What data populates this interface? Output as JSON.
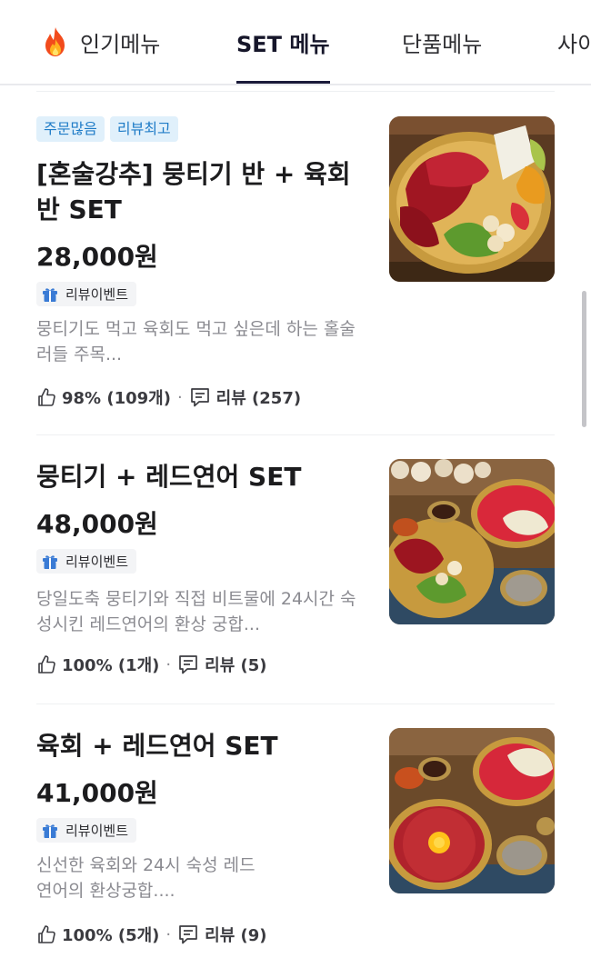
{
  "tabs": [
    {
      "label": "인기메뉴",
      "icon": "fire-icon",
      "active": false
    },
    {
      "label": "SET 메뉴",
      "active": true
    },
    {
      "label": "단품메뉴",
      "active": false
    },
    {
      "label": "사이",
      "active": false
    }
  ],
  "items": [
    {
      "badges": [
        "주문많음",
        "리뷰최고"
      ],
      "title": "[혼술강추] 뭉티기 반 + 육회 반 SET",
      "price": "28,000원",
      "event_label": "리뷰이벤트",
      "description": "뭉티기도 먹고 육회도 먹고 싶은데 하는 홀술러들 주목...",
      "likes": "98% (109개)",
      "reviews": "리뷰 (257)",
      "image": "food-platter-photo"
    },
    {
      "badges": [],
      "title": "뭉티기 + 레드연어 SET",
      "price": "48,000원",
      "event_label": "리뷰이벤트",
      "description": "당일도축 뭉티기와 직접 비트물에 24시간 숙성시킨 레드연어의 환상 궁합...",
      "likes": "100% (1개)",
      "reviews": "리뷰 (5)",
      "image": "food-platter-photo"
    },
    {
      "badges": [],
      "title": "육회 + 레드연어 SET",
      "price": "41,000원",
      "event_label": "리뷰이벤트",
      "description": "신선한 육회와 24시 숙성 레드연어의 환상궁합....",
      "likes": "100% (5개)",
      "reviews": "리뷰 (9)",
      "image": "food-platter-photo"
    }
  ],
  "colors": {
    "badge_bg": "#e0f0fb",
    "badge_text": "#1f7cc7",
    "active_tab_underline": "#1a1a3a",
    "description_text": "#8b8b91"
  }
}
